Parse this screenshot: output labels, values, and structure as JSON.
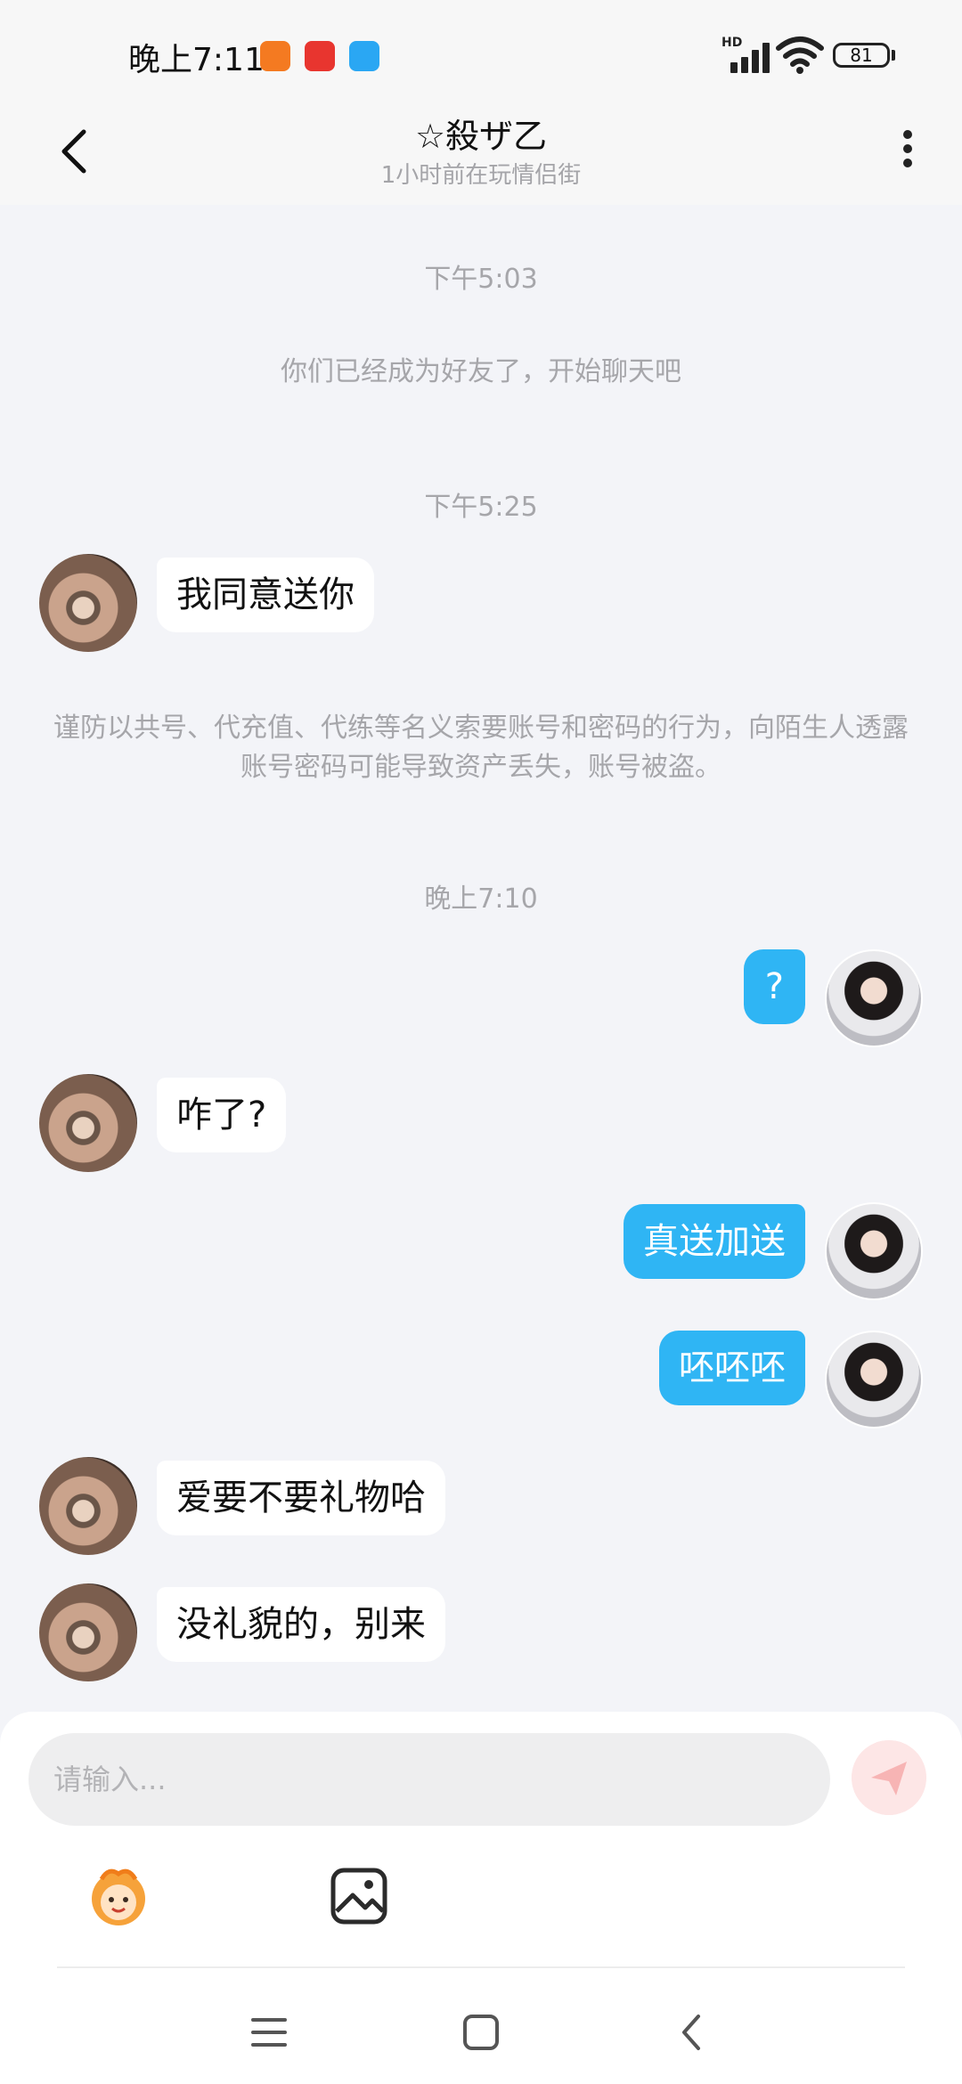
{
  "status_bar": {
    "time": "晚上7:11",
    "network": "HD",
    "battery": "81",
    "icons": [
      "mi-app-icon",
      "kandian-app-icon",
      "message-app-icon",
      "signal-icon",
      "wifi-icon",
      "battery-icon"
    ]
  },
  "header": {
    "title": "☆殺ザ乙",
    "subtitle": "1小时前在玩情侣街",
    "back_icon": "back-arrow-icon",
    "more_icon": "more-vertical-icon"
  },
  "chat": {
    "timestamps": [
      "下午5:03",
      "下午5:25",
      "晚上7:10"
    ],
    "system_notices": [
      "你们已经成为好友了，开始聊天吧",
      "谨防以共号、代充值、代练等名义索要账号和密码的行为，向陌生人透露账号密码可能导致资产丢失，账号被盗。"
    ],
    "messages": [
      {
        "side": "left",
        "text": "我同意送你"
      },
      {
        "side": "right",
        "text": "?"
      },
      {
        "side": "left",
        "text": "咋了?"
      },
      {
        "side": "right",
        "text": "真送加送"
      },
      {
        "side": "right",
        "text": "呸呸呸"
      },
      {
        "side": "left",
        "text": "爱要不要礼物哈"
      },
      {
        "side": "left",
        "text": "没礼貌的，别来"
      }
    ]
  },
  "composer": {
    "placeholder": "请输入...",
    "send_icon": "send-icon",
    "tools": [
      "sticker-icon",
      "image-icon"
    ]
  },
  "nav_bar": {
    "icons": [
      "menu-nav-icon",
      "home-nav-icon",
      "back-nav-icon"
    ]
  },
  "colors": {
    "accent": "#2fb5f4",
    "background": "#f3f4f8",
    "send_button": "#fde6e6"
  }
}
